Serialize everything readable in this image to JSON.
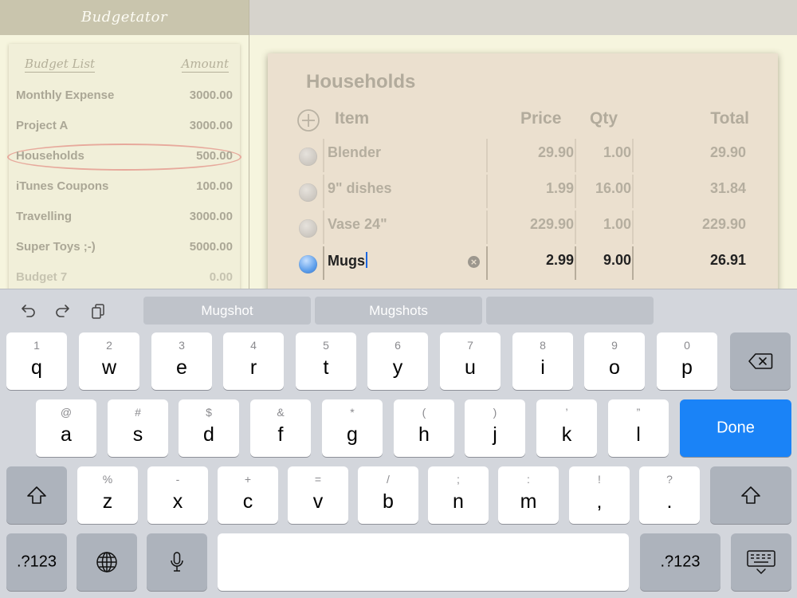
{
  "app": {
    "title": "Budgetator"
  },
  "budget_list": {
    "header_name": "Budget List",
    "header_amount": "Amount",
    "items": [
      {
        "name": "Monthly Expense",
        "amount": "3000.00"
      },
      {
        "name": "Project A",
        "amount": "3000.00"
      },
      {
        "name": "Households",
        "amount": "500.00"
      },
      {
        "name": "iTunes Coupons",
        "amount": "100.00"
      },
      {
        "name": "Travelling",
        "amount": "3000.00"
      },
      {
        "name": "Super Toys ;-)",
        "amount": "5000.00"
      },
      {
        "name": "Budget 7",
        "amount": "0.00"
      }
    ]
  },
  "detail": {
    "title": "Households",
    "columns": {
      "item": "Item",
      "price": "Price",
      "qty": "Qty",
      "total": "Total"
    },
    "rows": [
      {
        "item": "Blender",
        "price": "29.90",
        "qty": "1.00",
        "total": "29.90"
      },
      {
        "item": "9\" dishes",
        "price": "1.99",
        "qty": "16.00",
        "total": "31.84"
      },
      {
        "item": "Vase 24\"",
        "price": "229.90",
        "qty": "1.00",
        "total": "229.90"
      },
      {
        "item": "Mugs",
        "price": "2.99",
        "qty": "9.00",
        "total": "26.91"
      }
    ]
  },
  "keyboard": {
    "suggestions": [
      "Mugshot",
      "Mugshots",
      ""
    ],
    "row1": [
      {
        "alt": "1",
        "key": "q"
      },
      {
        "alt": "2",
        "key": "w"
      },
      {
        "alt": "3",
        "key": "e"
      },
      {
        "alt": "4",
        "key": "r"
      },
      {
        "alt": "5",
        "key": "t"
      },
      {
        "alt": "6",
        "key": "y"
      },
      {
        "alt": "7",
        "key": "u"
      },
      {
        "alt": "8",
        "key": "i"
      },
      {
        "alt": "9",
        "key": "o"
      },
      {
        "alt": "0",
        "key": "p"
      }
    ],
    "row2": [
      {
        "alt": "@",
        "key": "a"
      },
      {
        "alt": "#",
        "key": "s"
      },
      {
        "alt": "$",
        "key": "d"
      },
      {
        "alt": "&",
        "key": "f"
      },
      {
        "alt": "*",
        "key": "g"
      },
      {
        "alt": "(",
        "key": "h"
      },
      {
        "alt": ")",
        "key": "j"
      },
      {
        "alt": "’",
        "key": "k"
      },
      {
        "alt": "”",
        "key": "l"
      }
    ],
    "row3": [
      {
        "alt": "%",
        "key": "z"
      },
      {
        "alt": "-",
        "key": "x"
      },
      {
        "alt": "+",
        "key": "c"
      },
      {
        "alt": "=",
        "key": "v"
      },
      {
        "alt": "/",
        "key": "b"
      },
      {
        "alt": ";",
        "key": "n"
      },
      {
        "alt": ":",
        "key": "m"
      },
      {
        "alt": "!",
        "key": ","
      },
      {
        "alt": "?",
        "key": "."
      }
    ],
    "done_label": "Done",
    "numbers_label": ".?123",
    "colors": {
      "done": "#1a83f7",
      "caret": "#1a66e0"
    }
  }
}
